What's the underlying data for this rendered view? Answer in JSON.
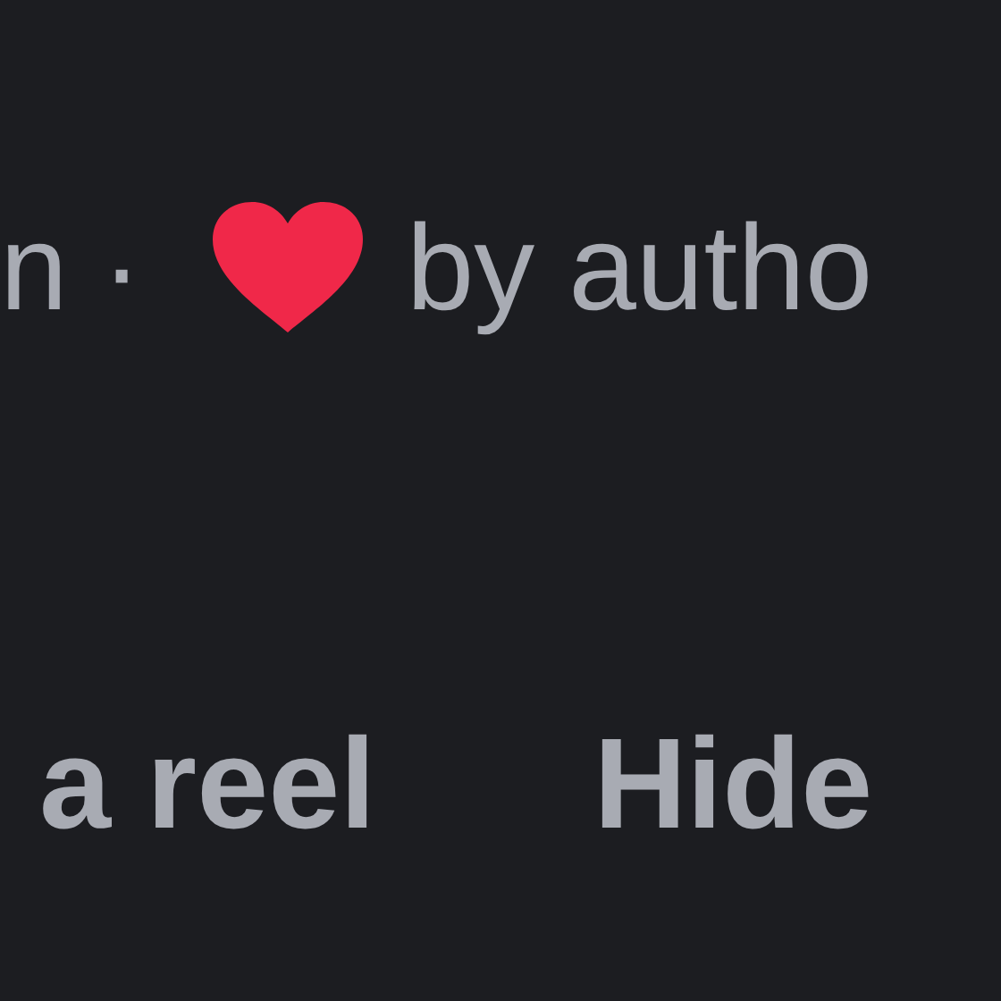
{
  "meta_line": {
    "fragment": "n ·",
    "reaction": {
      "kind": "heart",
      "color": "#f02849"
    },
    "credit": "by autho"
  },
  "actions": [
    {
      "label": "a reel"
    },
    {
      "label": "Hide"
    }
  ]
}
